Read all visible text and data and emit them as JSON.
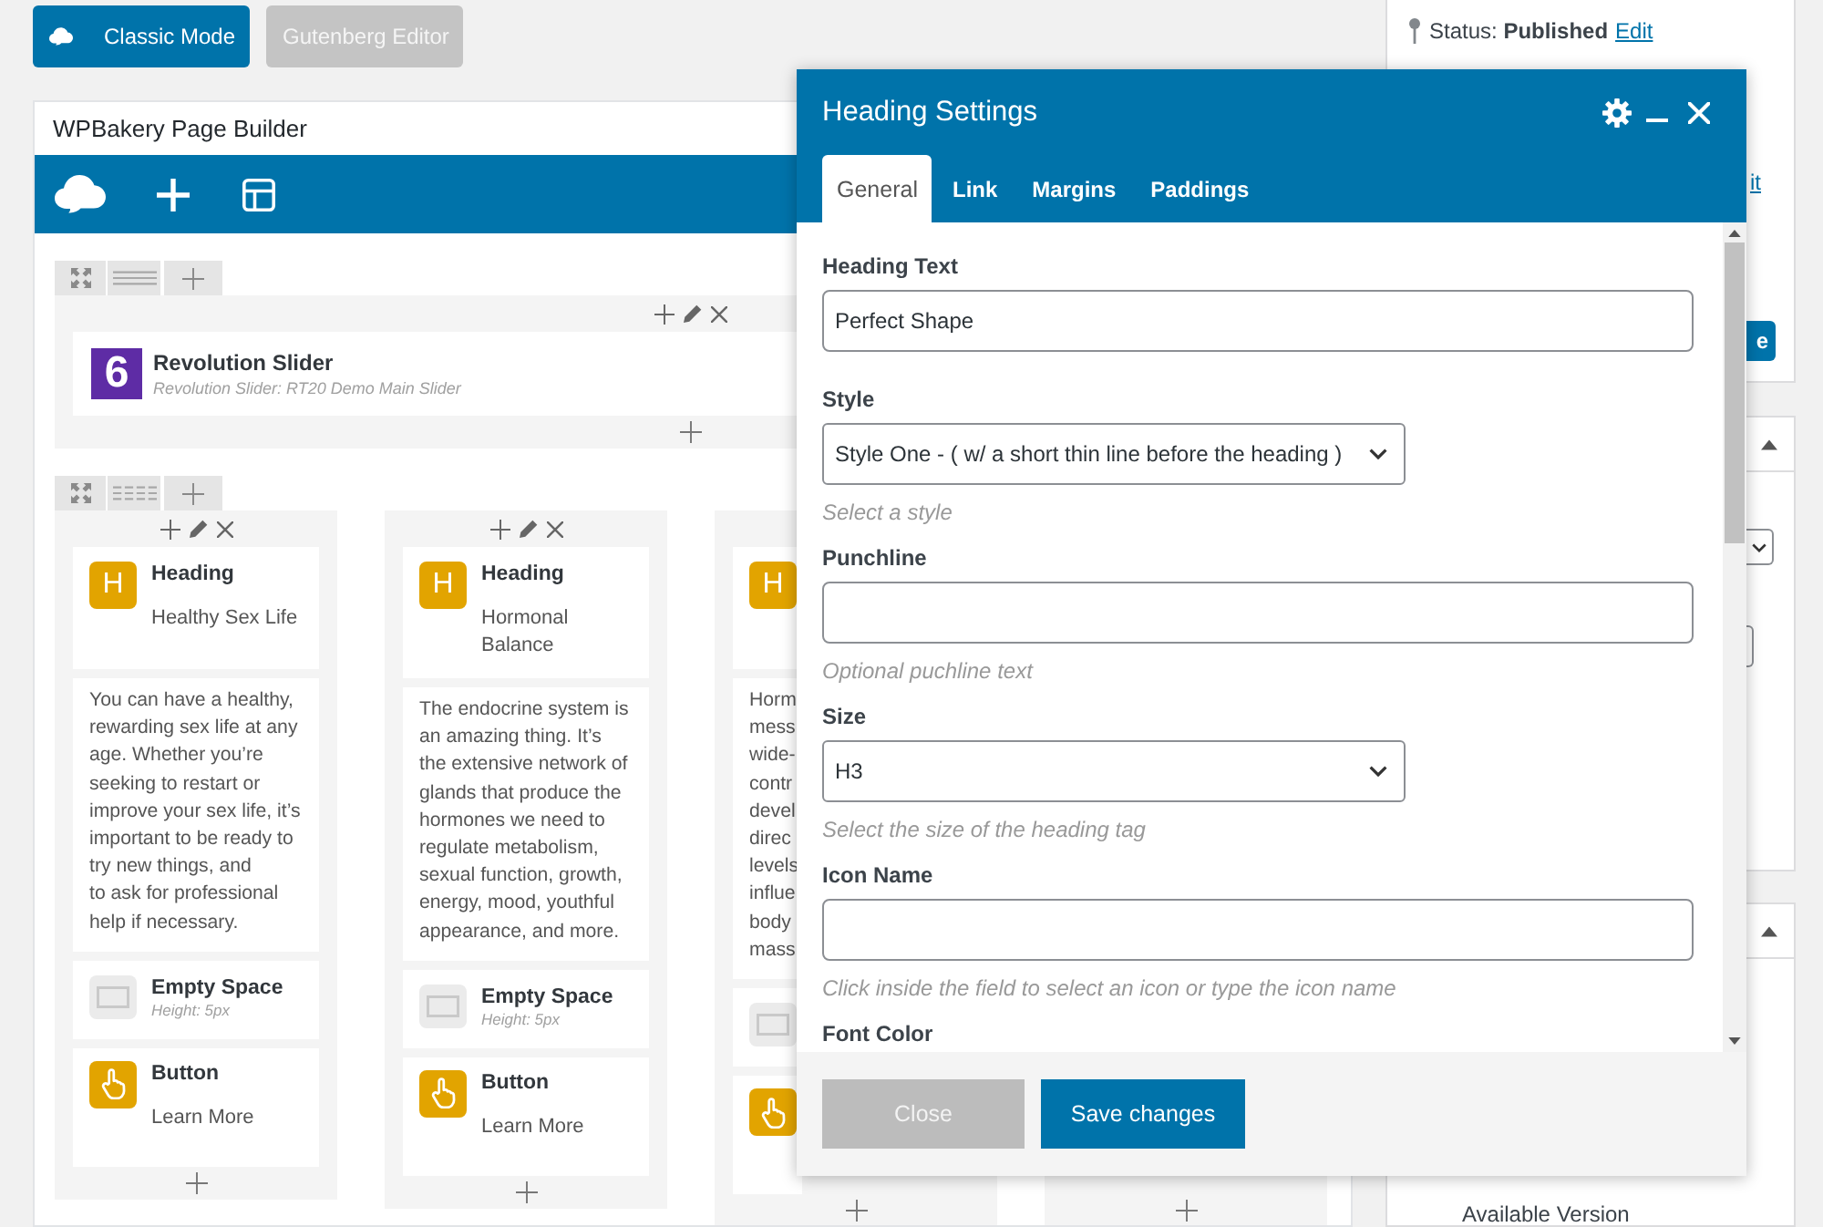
{
  "editor_modes": [
    {
      "kind": "branded",
      "label": "Classic Mode",
      "selected": true
    },
    {
      "kind": "plain",
      "label": "Gutenberg Editor",
      "selected": false
    }
  ],
  "builder": {
    "title": "WPBakery Page Builder",
    "rows": [
      {
        "columns": [
          {
            "partly_hidden": false,
            "elements": [
              {
                "kind": "plugin",
                "icon_label": "6",
                "title": "Revolution Slider",
                "subtitle": "Revolution Slider: RT20 Demo Main Slider"
              }
            ]
          }
        ]
      },
      {
        "columns": [
          {
            "partly_hidden": false,
            "elements": [
              {
                "kind": "heading",
                "icon_label": "H",
                "title": "Heading",
                "text": "Healthy Sex Life"
              },
              {
                "kind": "text",
                "text": "You can have a healthy, rewarding sex life at any age. Whether you’re seeking to restart or improve your sex life, it’s important to be ready to try new things, and\nto ask for professional help if necessary."
              },
              {
                "kind": "empty_space",
                "title": "Empty Space",
                "subtitle": "Height: 5px"
              },
              {
                "kind": "button",
                "title": "Button",
                "text": "Learn More"
              }
            ]
          },
          {
            "partly_hidden": false,
            "elements": [
              {
                "kind": "heading",
                "icon_label": "H",
                "title": "Heading",
                "text": "Hormonal Balance"
              },
              {
                "kind": "text",
                "text": "The endocrine system is an amazing thing. It’s the extensive network of glands that produce the hormones we need to regulate metabolism, sexual function, growth, energy, mood, youthful appearance, and more."
              },
              {
                "kind": "empty_space",
                "title": "Empty Space",
                "subtitle": "Height: 5px"
              },
              {
                "kind": "button",
                "title": "Button",
                "text": "Learn More"
              }
            ]
          },
          {
            "partly_hidden": true,
            "elements": [
              {
                "kind": "heading",
                "icon_label": "H"
              },
              {
                "kind": "text",
                "text": "Horm\nmess\nwide-\ncontr\ndevel\ndirec\nlevels\ninflue\nbody\nmass"
              },
              {
                "kind": "empty_space"
              },
              {
                "kind": "button"
              }
            ]
          },
          {
            "partly_hidden": true
          }
        ]
      }
    ]
  },
  "dialog": {
    "title": "Heading Settings",
    "tabs": [
      {
        "label": "General",
        "selected": true
      },
      {
        "label": "Link",
        "selected": false
      },
      {
        "label": "Margins",
        "selected": false
      },
      {
        "label": "Paddings",
        "selected": false
      }
    ],
    "fields": [
      {
        "kind": "text",
        "label": "Heading Text",
        "value": "Perfect Shape"
      },
      {
        "kind": "select",
        "label": "Style",
        "value": "Style One - ( w/ a short thin line before the heading )",
        "hint": "Select a style"
      },
      {
        "kind": "text",
        "label": "Punchline",
        "hint": "Optional puchline text"
      },
      {
        "kind": "select",
        "label": "Size",
        "value": "H3",
        "hint": "Select the size of the heading tag"
      },
      {
        "kind": "text",
        "label": "Icon Name",
        "hint": "Click inside the field to select an icon or type the icon name"
      },
      {
        "kind": "label",
        "label": "Font Color"
      }
    ],
    "buttons": [
      {
        "kind": "secondary",
        "label": "Close"
      },
      {
        "kind": "primary",
        "label": "Save changes"
      }
    ]
  },
  "sidebar": {
    "publish": {
      "status": "Status: **Published**",
      "status_link": "Edit",
      "second_link": "it",
      "button": "e"
    },
    "panels": [
      {
        "expanded": true,
        "fields": [
          {
            "kind": "select"
          },
          {
            "kind": "input"
          }
        ]
      },
      {
        "expanded": true,
        "items": [
          {
            "label": "Available Version"
          }
        ]
      }
    ]
  }
}
